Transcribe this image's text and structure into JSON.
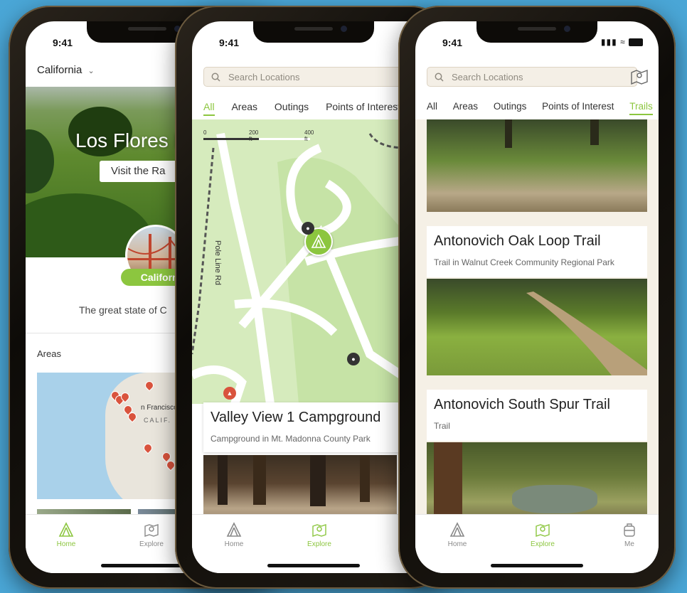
{
  "colors": {
    "accent": "#8cc63f",
    "pin": "#d9533d",
    "background": "#4aa6d6"
  },
  "status": {
    "time": "9:41"
  },
  "phone1": {
    "region": "California",
    "hero_title": "Los Flores Rar",
    "hero_button": "Visit the Ra",
    "badge": "California",
    "description": "The great state of C",
    "areas_label": "Areas",
    "map_labels": {
      "city": "n Francisco",
      "state": "CALIF."
    }
  },
  "phone2": {
    "search_placeholder": "Search Locations",
    "filters": [
      "All",
      "Areas",
      "Outings",
      "Points of Interest"
    ],
    "selected_filter": "All",
    "scale": {
      "zero": "0",
      "mid": "200 ft",
      "end": "400 ft"
    },
    "road_label": "Pole Line Rd",
    "card": {
      "title": "Valley View 1 Campground",
      "subtitle": "Campground in Mt. Madonna County Park"
    }
  },
  "phone3": {
    "search_placeholder": "Search Locations",
    "filters": [
      "All",
      "Areas",
      "Outings",
      "Points of Interest",
      "Trails"
    ],
    "selected_filter": "Trails",
    "cards": [
      {
        "title": "Antonovich Oak Loop Trail",
        "subtitle": "Trail in Walnut Creek Community Regional Park"
      },
      {
        "title": "Antonovich South Spur Trail",
        "subtitle": "Trail"
      }
    ]
  },
  "tabbar": {
    "home": "Home",
    "explore": "Explore",
    "me": "Me"
  }
}
